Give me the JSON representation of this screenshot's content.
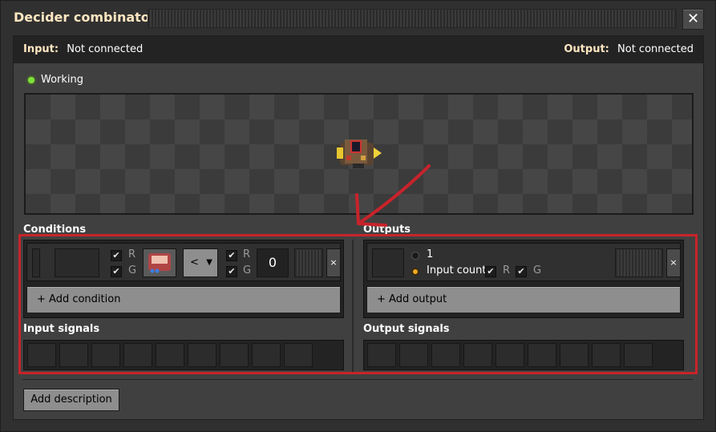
{
  "window": {
    "title": "Decider combinator",
    "close_icon": "close-icon"
  },
  "connection": {
    "input_label": "Input:",
    "input_value": "Not connected",
    "output_label": "Output:",
    "output_value": "Not connected"
  },
  "status": {
    "text": "Working",
    "color": "#7ee23a"
  },
  "conditions": {
    "title": "Conditions",
    "row": {
      "red_label": "R",
      "green_label": "G",
      "left_signal_icon": "signal-icon",
      "comparator": "<",
      "constant": "0",
      "right_red_label": "R",
      "right_green_label": "G",
      "remove_label": "×"
    },
    "add_label": "+ Add condition"
  },
  "outputs": {
    "title": "Outputs",
    "row": {
      "option_one": "1",
      "option_input_count": "Input count",
      "red_label": "R",
      "green_label": "G",
      "remove_label": "×"
    },
    "add_label": "+ Add output"
  },
  "input_signals": {
    "title": "Input signals"
  },
  "output_signals": {
    "title": "Output signals"
  },
  "description": {
    "button_label": "Add description"
  },
  "annotation": {
    "highlight_color": "#c8232a",
    "arrow_icon": "arrow-icon"
  }
}
